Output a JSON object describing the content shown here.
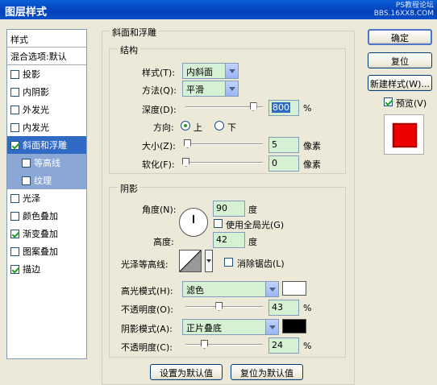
{
  "window": {
    "title": "图层样式",
    "watermark_line1": "PS教程论坛",
    "watermark_line2": "BBS.16XX8.COM"
  },
  "left_panel": {
    "header": "样式",
    "blend": "混合选项:默认",
    "items": [
      {
        "label": "投影",
        "checked": false
      },
      {
        "label": "内阴影",
        "checked": false
      },
      {
        "label": "外发光",
        "checked": false
      },
      {
        "label": "内发光",
        "checked": false
      },
      {
        "label": "斜面和浮雕",
        "checked": true
      },
      {
        "label": "等高线",
        "checked": false
      },
      {
        "label": "纹理",
        "checked": false
      },
      {
        "label": "光泽",
        "checked": false
      },
      {
        "label": "颜色叠加",
        "checked": false
      },
      {
        "label": "渐变叠加",
        "checked": true
      },
      {
        "label": "图案叠加",
        "checked": false
      },
      {
        "label": "描边",
        "checked": true
      }
    ]
  },
  "bevel": {
    "group_title": "斜面和浮雕",
    "structure_title": "结构",
    "style_label": "样式(T):",
    "style_value": "内斜面",
    "method_label": "方法(Q):",
    "method_value": "平滑",
    "depth_label": "深度(D):",
    "depth_value": "800",
    "depth_unit": "%",
    "depth_slider": 0.87,
    "direction_label": "方向:",
    "dir_up": "上",
    "dir_down": "下",
    "size_label": "大小(Z):",
    "size_value": "5",
    "size_unit": "像素",
    "size_slider": 0.02,
    "soften_label": "软化(F):",
    "soften_value": "0",
    "soften_unit": "像素",
    "soften_slider": 0.0
  },
  "shading": {
    "title": "阴影",
    "angle_label": "角度(N):",
    "angle_value": "90",
    "angle_unit": "度",
    "global_light_label": "使用全局光(G)",
    "global_light": false,
    "altitude_label": "高度:",
    "altitude_value": "42",
    "altitude_unit": "度",
    "gloss_label": "光泽等高线:",
    "antialias_label": "消除锯齿(L)",
    "antialias": false,
    "highlight_label": "高光模式(H):",
    "highlight_value": "滤色",
    "highlight_color": "#ffffff",
    "hl_opacity_label": "不透明度(O):",
    "hl_opacity_value": "43",
    "hl_opacity_unit": "%",
    "hl_opacity_slider": 0.43,
    "shadow_label": "阴影模式(A):",
    "shadow_value": "正片叠底",
    "shadow_color": "#000000",
    "sh_opacity_label": "不透明度(C):",
    "sh_opacity_value": "24",
    "sh_opacity_unit": "%",
    "sh_opacity_slider": 0.24
  },
  "buttons": {
    "ok": "确定",
    "reset": "复位",
    "new_style": "新建样式(W)...",
    "preview_label": "预览(V)",
    "preview": true,
    "make_default": "设置为默认值",
    "reset_default": "复位为默认值"
  }
}
